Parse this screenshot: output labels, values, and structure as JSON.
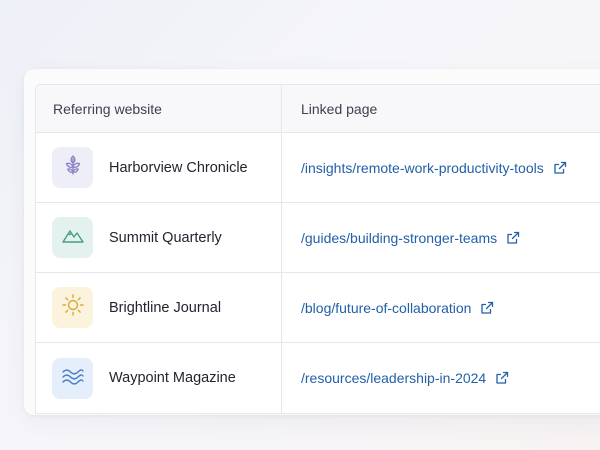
{
  "table": {
    "headers": {
      "website": "Referring website",
      "page": "Linked page"
    },
    "rows": [
      {
        "site": "Harborview Chronicle",
        "page": "/insights/remote-work-productivity-tools",
        "icon": "leaf-icon",
        "tile_color": "#eeeef9",
        "icon_color": "#8b86c4"
      },
      {
        "site": "Summit Quarterly",
        "page": "/guides/building-stronger-teams",
        "icon": "mountain-icon",
        "tile_color": "#e4f2ef",
        "icon_color": "#4d9a8b"
      },
      {
        "site": "Brightline Journal",
        "page": "/blog/future-of-collaboration",
        "icon": "sun-icon",
        "tile_color": "#fbf3dc",
        "icon_color": "#d7a93a"
      },
      {
        "site": "Waypoint Magazine",
        "page": "/resources/leadership-in-2024",
        "icon": "waves-icon",
        "tile_color": "#e5eefb",
        "icon_color": "#4a7fc0"
      }
    ]
  },
  "colors": {
    "link": "#2360a8",
    "text": "#22252e",
    "header_text": "#3d4150"
  }
}
